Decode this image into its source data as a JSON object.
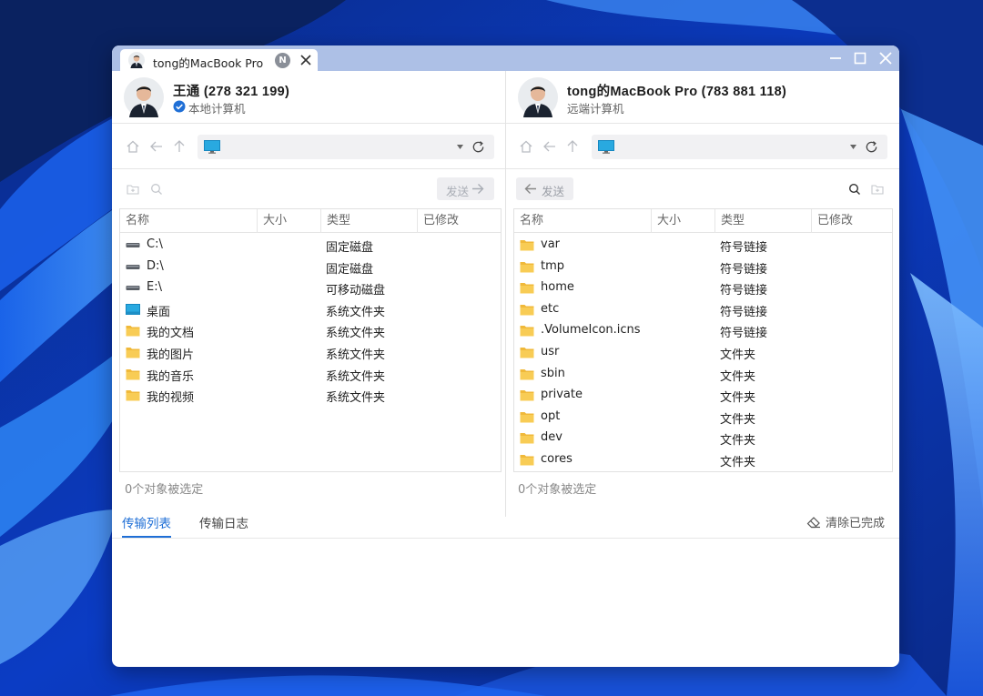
{
  "colors": {
    "accent": "#1f6fd6",
    "titlebar": "#adc0e6",
    "folder": "#f5c242",
    "verified": "#1f6fd6"
  },
  "tab": {
    "title": "tong的MacBook Pro",
    "badge": "N"
  },
  "local": {
    "name": "王通 (278 321 199)",
    "subtitle": "本地计算机",
    "send_label": "发送",
    "columns": [
      "名称",
      "大小",
      "类型",
      "已修改"
    ],
    "rows": [
      {
        "name": "C:\\",
        "icon": "drive-icon",
        "type": "固定磁盘"
      },
      {
        "name": "D:\\",
        "icon": "drive-icon",
        "type": "固定磁盘"
      },
      {
        "name": "E:\\",
        "icon": "drive-icon",
        "type": "可移动磁盘"
      },
      {
        "name": "桌面",
        "icon": "desktop-icon",
        "type": "系统文件夹"
      },
      {
        "name": "我的文档",
        "icon": "folder-icon",
        "type": "系统文件夹"
      },
      {
        "name": "我的图片",
        "icon": "folder-icon",
        "type": "系统文件夹"
      },
      {
        "name": "我的音乐",
        "icon": "folder-icon",
        "type": "系统文件夹"
      },
      {
        "name": "我的视频",
        "icon": "folder-icon",
        "type": "系统文件夹"
      }
    ],
    "status": "0个对象被选定"
  },
  "remote": {
    "name": "tong的MacBook Pro (783 881 118)",
    "subtitle": "远端计算机",
    "send_label": "发送",
    "columns": [
      "名称",
      "大小",
      "类型",
      "已修改"
    ],
    "rows": [
      {
        "name": "var",
        "icon": "folder-icon",
        "type": "符号链接"
      },
      {
        "name": "tmp",
        "icon": "folder-icon",
        "type": "符号链接"
      },
      {
        "name": "home",
        "icon": "folder-icon",
        "type": "符号链接"
      },
      {
        "name": "etc",
        "icon": "folder-icon",
        "type": "符号链接"
      },
      {
        "name": ".VolumeIcon.icns",
        "icon": "folder-icon",
        "type": "符号链接"
      },
      {
        "name": "usr",
        "icon": "folder-icon",
        "type": "文件夹"
      },
      {
        "name": "sbin",
        "icon": "folder-icon",
        "type": "文件夹"
      },
      {
        "name": "private",
        "icon": "folder-icon",
        "type": "文件夹"
      },
      {
        "name": "opt",
        "icon": "folder-icon",
        "type": "文件夹"
      },
      {
        "name": "dev",
        "icon": "folder-icon",
        "type": "文件夹"
      },
      {
        "name": "cores",
        "icon": "folder-icon",
        "type": "文件夹"
      }
    ],
    "status": "0个对象被选定"
  },
  "transfer": {
    "tabs": [
      "传输列表",
      "传输日志"
    ],
    "active_tab": 0,
    "clear_label": "清除已完成"
  }
}
